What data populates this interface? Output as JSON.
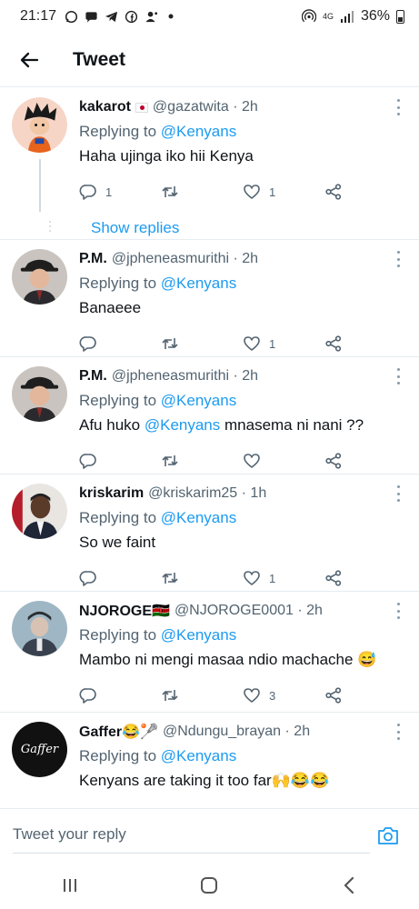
{
  "status_bar": {
    "time": "21:17",
    "network": "4G",
    "battery": "36%"
  },
  "header": {
    "title": "Tweet"
  },
  "tweets": [
    {
      "name": "kakarot",
      "handle": "@gazatwita",
      "time": "2h",
      "reply_prefix": "Replying to",
      "reply_to": "@Kenyans",
      "text": "Haha ujinga iko hii Kenya",
      "replies": "1",
      "retweets": "",
      "likes": "1",
      "show_replies": "Show replies"
    },
    {
      "name": "P.M.",
      "handle": "@jpheneasmurithi",
      "time": "2h",
      "reply_prefix": "Replying to",
      "reply_to": "@Kenyans",
      "text": "Banaeee",
      "replies": "",
      "retweets": "",
      "likes": "1"
    },
    {
      "name": "P.M.",
      "handle": "@jpheneasmurithi",
      "time": "2h",
      "reply_prefix": "Replying to",
      "reply_to": "@Kenyans",
      "text_pre": "Afu huko",
      "text_mention": "@Kenyans",
      "text_post": "mnasema ni nani ??",
      "replies": "",
      "retweets": "",
      "likes": ""
    },
    {
      "name": "kriskarim",
      "handle": "@kriskarim25",
      "time": "1h",
      "reply_prefix": "Replying to",
      "reply_to": "@Kenyans",
      "text": "So we faint",
      "replies": "",
      "retweets": "",
      "likes": "1"
    },
    {
      "name": "NJOROGE🇰🇪",
      "handle": "@NJOROGE0001",
      "time": "2h",
      "reply_prefix": "Replying to",
      "reply_to": "@Kenyans",
      "text": "Mambo ni mengi masaa ndio machache 😅",
      "replies": "",
      "retweets": "",
      "likes": "3"
    },
    {
      "name": "Gaffer😂🥍",
      "handle": "@Ndungu_brayan",
      "time": "2h",
      "reply_prefix": "Replying to",
      "reply_to": "@Kenyans",
      "text": "Kenyans are taking it too far🙌😂😂",
      "avatar_text": "Gaffer"
    }
  ],
  "reply_bar": {
    "placeholder": "Tweet your reply"
  },
  "colors": {
    "accent": "#1d9bf0",
    "text": "#0f1419",
    "secondary": "#536471"
  }
}
